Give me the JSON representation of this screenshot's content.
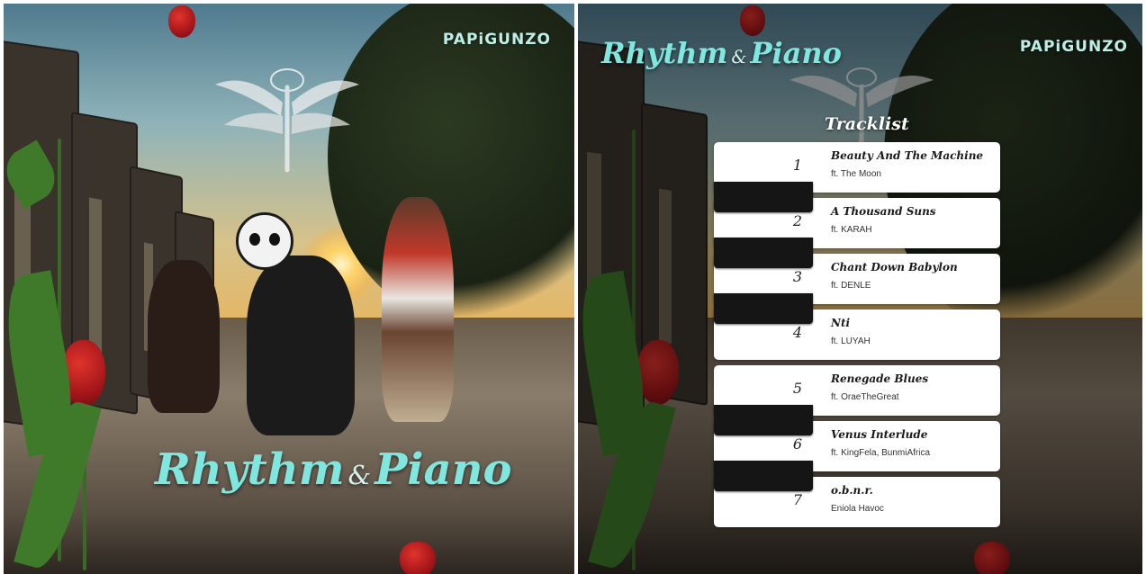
{
  "cover": {
    "brand": "PAPiGUNZO",
    "title_left": "Rhythm",
    "title_amp": "&",
    "title_right": "Piano"
  },
  "back": {
    "brand": "PAPiGUNZO",
    "title_left": "Rhythm",
    "title_amp": "&",
    "title_right": "Piano",
    "tracklist_label": "Tracklist",
    "tracks": [
      {
        "number": "1",
        "title": "Beauty And The Machine",
        "featuring": "ft. The Moon"
      },
      {
        "number": "2",
        "title": "A Thousand Suns",
        "featuring": "ft. KARAH"
      },
      {
        "number": "3",
        "title": "Chant Down Babylon",
        "featuring": "ft. DENLE"
      },
      {
        "number": "4",
        "title": "Nti",
        "featuring": "ft. LUYAH"
      },
      {
        "number": "5",
        "title": "Renegade Blues",
        "featuring": "ft. OraeTheGreat"
      },
      {
        "number": "6",
        "title": "Venus Interlude",
        "featuring": "ft. KingFela, BunmiAfrica"
      },
      {
        "number": "7",
        "title": "o.b.n.r.",
        "featuring": "Eniola Havoc"
      }
    ]
  },
  "colors": {
    "title_teal": "#7fe7e0",
    "brand_mint": "#bfeee6",
    "key_white": "#ffffff",
    "key_black": "#151515"
  },
  "icons": [
    "angel-cloud-icon",
    "tulip-icon"
  ]
}
